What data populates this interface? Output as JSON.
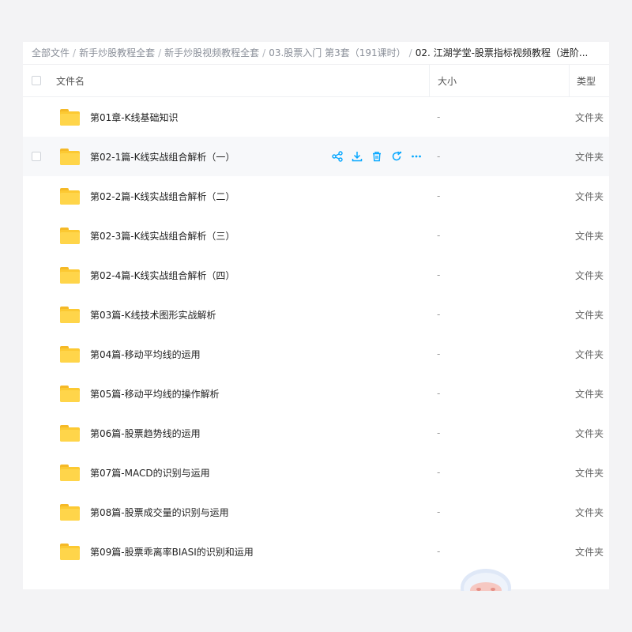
{
  "breadcrumb": {
    "items": [
      "全部文件",
      "新手炒股教程全套",
      "新手炒股视频教程全套",
      "03.股票入门 第3套（191课时）"
    ],
    "current": "02. 江湖学堂-股票指标视频教程（进阶..."
  },
  "table": {
    "headers": {
      "name": "文件名",
      "size": "大小",
      "type": "类型"
    },
    "rows": [
      {
        "name": "第01章-K线基础知识",
        "size": "-",
        "type": "文件夹"
      },
      {
        "name": "第02-1篇-K线实战组合解析（一）",
        "size": "-",
        "type": "文件夹"
      },
      {
        "name": "第02-2篇-K线实战组合解析（二）",
        "size": "-",
        "type": "文件夹"
      },
      {
        "name": "第02-3篇-K线实战组合解析（三）",
        "size": "-",
        "type": "文件夹"
      },
      {
        "name": "第02-4篇-K线实战组合解析（四）",
        "size": "-",
        "type": "文件夹"
      },
      {
        "name": "第03篇-K线技术图形实战解析",
        "size": "-",
        "type": "文件夹"
      },
      {
        "name": "第04篇-移动平均线的运用",
        "size": "-",
        "type": "文件夹"
      },
      {
        "name": "第05篇-移动平均线的操作解析",
        "size": "-",
        "type": "文件夹"
      },
      {
        "name": "第06篇-股票趋势线的运用",
        "size": "-",
        "type": "文件夹"
      },
      {
        "name": "第07篇-MACD的识别与运用",
        "size": "-",
        "type": "文件夹"
      },
      {
        "name": "第08篇-股票成交量的识别与运用",
        "size": "-",
        "type": "文件夹"
      },
      {
        "name": "第09篇-股票乖离率BIASI的识别和运用",
        "size": "-",
        "type": "文件夹"
      }
    ]
  },
  "row_actions": [
    "share-icon",
    "download-icon",
    "delete-icon",
    "refresh-icon",
    "more-icon"
  ],
  "colors": {
    "accent": "#06a7ff",
    "folder": "#fcc932",
    "hover_row": "#f7f8fa"
  }
}
